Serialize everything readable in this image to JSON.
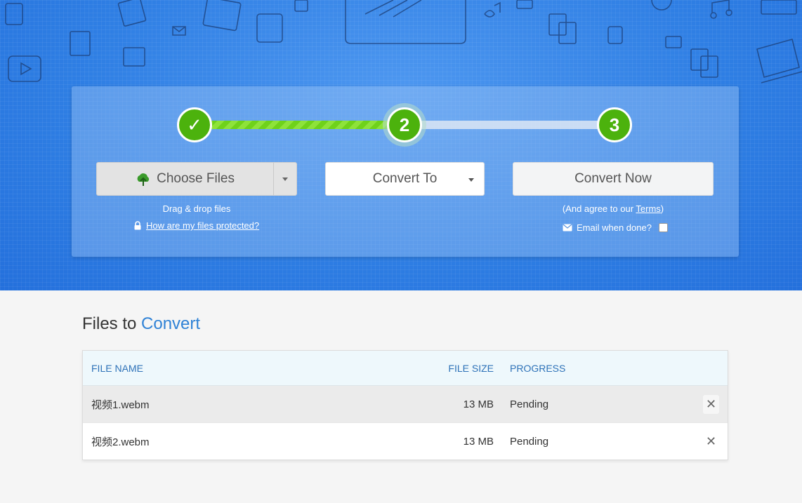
{
  "steps": {
    "s1": "✓",
    "s2": "2",
    "s3": "3"
  },
  "buttons": {
    "choose_files": "Choose Files",
    "convert_to": "Convert To",
    "convert_now": "Convert Now"
  },
  "choose_help": {
    "drag_drop": "Drag & drop files",
    "protected_link": "How are my files protected?"
  },
  "convert_help": {
    "agree_prefix": "(And agree to our ",
    "terms_link": "Terms",
    "agree_suffix": ")",
    "email_label": "Email when done?"
  },
  "files": {
    "title_prefix": "Files to",
    "title_accent": "Convert",
    "columns": {
      "name": "FILE NAME",
      "size": "FILE SIZE",
      "progress": "PROGRESS"
    },
    "rows": [
      {
        "name": "视频1.webm",
        "size": "13 MB",
        "progress": "Pending",
        "remove": "✕"
      },
      {
        "name": "视频2.webm",
        "size": "13 MB",
        "progress": "Pending",
        "remove": "✕"
      }
    ]
  },
  "icons": [
    "cloud-upload-icon",
    "dropdown-caret-icon",
    "lock-icon",
    "envelope-icon",
    "remove-icon"
  ],
  "colors": {
    "hero_blue": "#2f7fe4",
    "step_green": "#4cb20d",
    "accent_blue": "#2f82d6",
    "progress_stripe": "#6fd21a"
  }
}
